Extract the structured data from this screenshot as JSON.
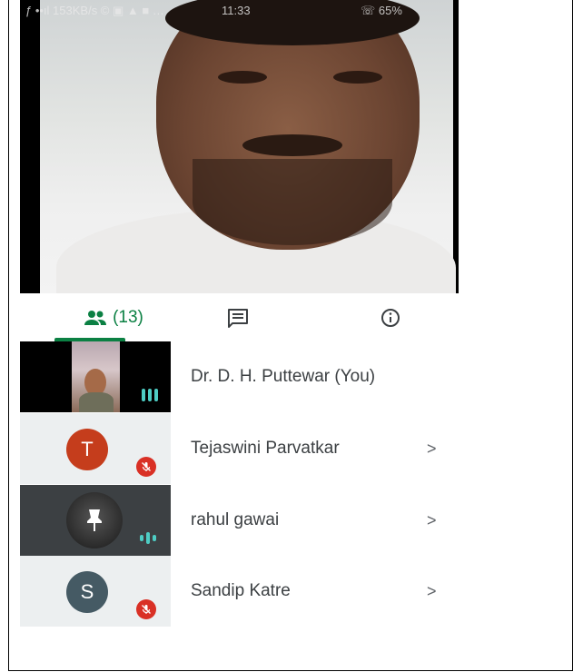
{
  "status_bar": {
    "left": "ƒ ••ıl 153KB/s © ▣ ▲ ■ …",
    "time": "11:33",
    "right": "☏ 65%"
  },
  "tabs": {
    "people_count": "(13)",
    "active": "people"
  },
  "participants": [
    {
      "name": "Dr. D. H. Puttewar (You)",
      "avatar_letter": "",
      "state": "speaking",
      "has_chevron": false
    },
    {
      "name": "Tejaswini Parvatkar",
      "avatar_letter": "T",
      "avatar_color": "#c53d1c",
      "state": "muted",
      "has_chevron": true
    },
    {
      "name": "rahul gawai",
      "avatar_letter": "",
      "state": "speaking",
      "has_chevron": true
    },
    {
      "name": "Sandip Katre",
      "avatar_letter": "S",
      "avatar_color": "#455a64",
      "state": "muted",
      "has_chevron": true
    }
  ],
  "colors": {
    "accent": "#0b8043",
    "mute": "#d93025",
    "audio_bars": "#4ecdc4"
  }
}
